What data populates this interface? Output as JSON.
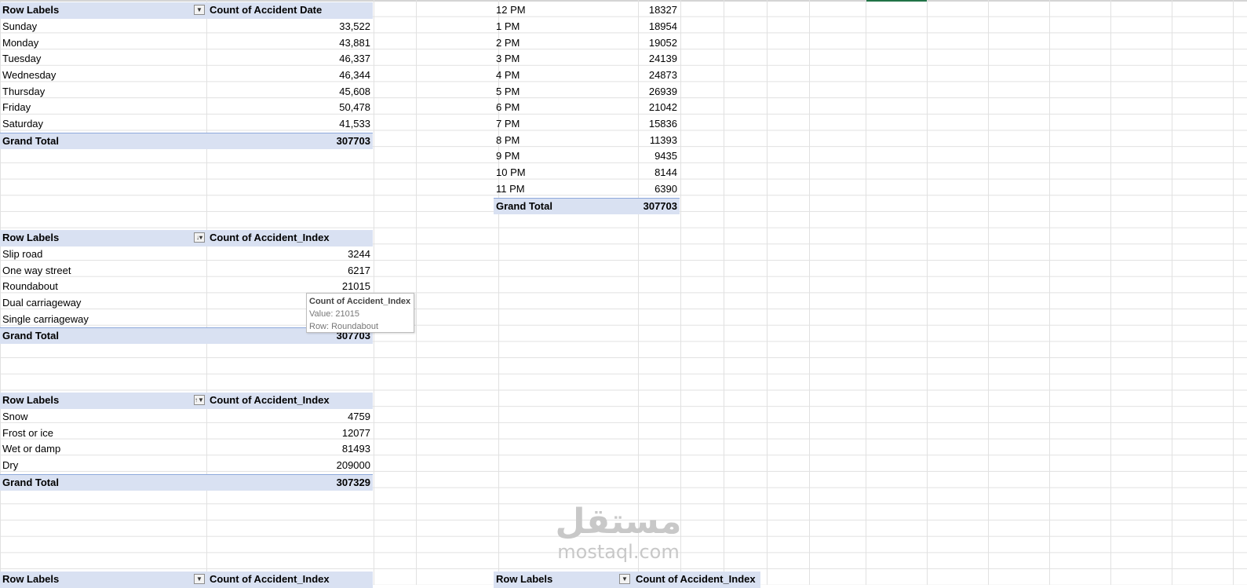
{
  "pivot_day": {
    "header_label": "Row Labels",
    "header_value": "Count of Accident Date",
    "rows": [
      {
        "label": "Sunday",
        "value": "33,522"
      },
      {
        "label": "Monday",
        "value": "43,881"
      },
      {
        "label": "Tuesday",
        "value": "46,337"
      },
      {
        "label": "Wednesday",
        "value": "46,344"
      },
      {
        "label": "Thursday",
        "value": "45,608"
      },
      {
        "label": "Friday",
        "value": "50,478"
      },
      {
        "label": "Saturday",
        "value": "41,533"
      }
    ],
    "total_label": "Grand Total",
    "total_value": "307703"
  },
  "pivot_hour": {
    "rows": [
      {
        "label": "12 PM",
        "value": "18327"
      },
      {
        "label": "1 PM",
        "value": "18954"
      },
      {
        "label": "2 PM",
        "value": "19052"
      },
      {
        "label": "3 PM",
        "value": "24139"
      },
      {
        "label": "4 PM",
        "value": "24873"
      },
      {
        "label": "5 PM",
        "value": "26939"
      },
      {
        "label": "6 PM",
        "value": "21042"
      },
      {
        "label": "7 PM",
        "value": "15836"
      },
      {
        "label": "8 PM",
        "value": "11393"
      },
      {
        "label": "9 PM",
        "value": "9435"
      },
      {
        "label": "10 PM",
        "value": "8144"
      },
      {
        "label": "11 PM",
        "value": "6390"
      }
    ],
    "total_label": "Grand Total",
    "total_value": "307703"
  },
  "pivot_road": {
    "header_label": "Row Labels",
    "header_value": "Count of Accident_Index",
    "rows": [
      {
        "label": "Slip road",
        "value": "3244"
      },
      {
        "label": "One way street",
        "value": "6217"
      },
      {
        "label": "Roundabout",
        "value": "21015"
      },
      {
        "label": "Dual carriageway",
        "value": ""
      },
      {
        "label": "Single carriageway",
        "value": ""
      }
    ],
    "total_label": "Grand Total",
    "total_value": "307703",
    "tooltip": {
      "title": "Count of Accident_Index",
      "value_line": "Value: 21015",
      "row_line": "Row: Roundabout"
    }
  },
  "pivot_surface": {
    "header_label": "Row Labels",
    "header_value": "Count of Accident_Index",
    "rows": [
      {
        "label": "Snow",
        "value": "4759"
      },
      {
        "label": "Frost or ice",
        "value": "12077"
      },
      {
        "label": "Wet or damp",
        "value": "81493"
      },
      {
        "label": "Dry",
        "value": "209000"
      }
    ],
    "total_label": "Grand Total",
    "total_value": "307329"
  },
  "partial_headers": {
    "left_label": "Row Labels",
    "left_value": "Count of Accident_Index",
    "right_label": "Row Labels",
    "right_value": "Count of Accident_Index"
  },
  "watermark": {
    "arabic": "مستقل",
    "latin": "mostaql.com"
  },
  "colors": {
    "header_fill": "#d9e1f2",
    "gridline": "#e1e1e1",
    "selection": "#217346"
  }
}
